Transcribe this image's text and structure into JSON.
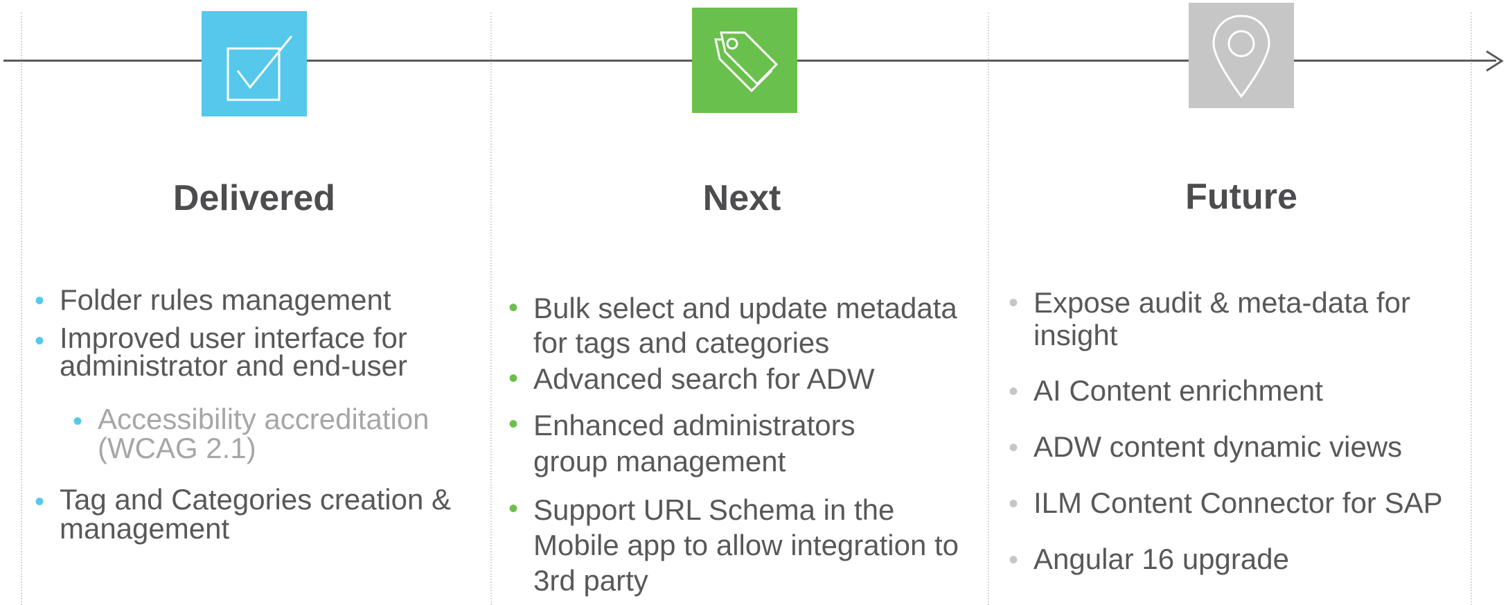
{
  "colors": {
    "delivered": "#55c8ec",
    "next": "#6ac04c",
    "future": "#c6c6c6",
    "timeline": "#5a5a5a",
    "text": "#58585a",
    "subtext": "#a6a6a6"
  },
  "columns": [
    {
      "heading": "Delivered",
      "icon": "checkbox-icon",
      "items": [
        "Folder rules management",
        "Improved user interface for administrator and end-user",
        "Accessibility accreditation (WCAG 2.1)",
        "Tag and Categories creation & management"
      ]
    },
    {
      "heading": "Next",
      "icon": "tags-icon",
      "items": [
        "Bulk select and update metadata for tags and categories",
        "Advanced search for ADW",
        "Enhanced administrators group management",
        "Support URL Schema in the Mobile app to allow integration to 3rd party"
      ]
    },
    {
      "heading": "Future",
      "icon": "map-pin-icon",
      "items": [
        "Expose audit & meta-data for insight",
        "AI Content enrichment",
        "ADW content dynamic views",
        "ILM Content Connector for SAP",
        "Angular 16 upgrade"
      ]
    }
  ]
}
